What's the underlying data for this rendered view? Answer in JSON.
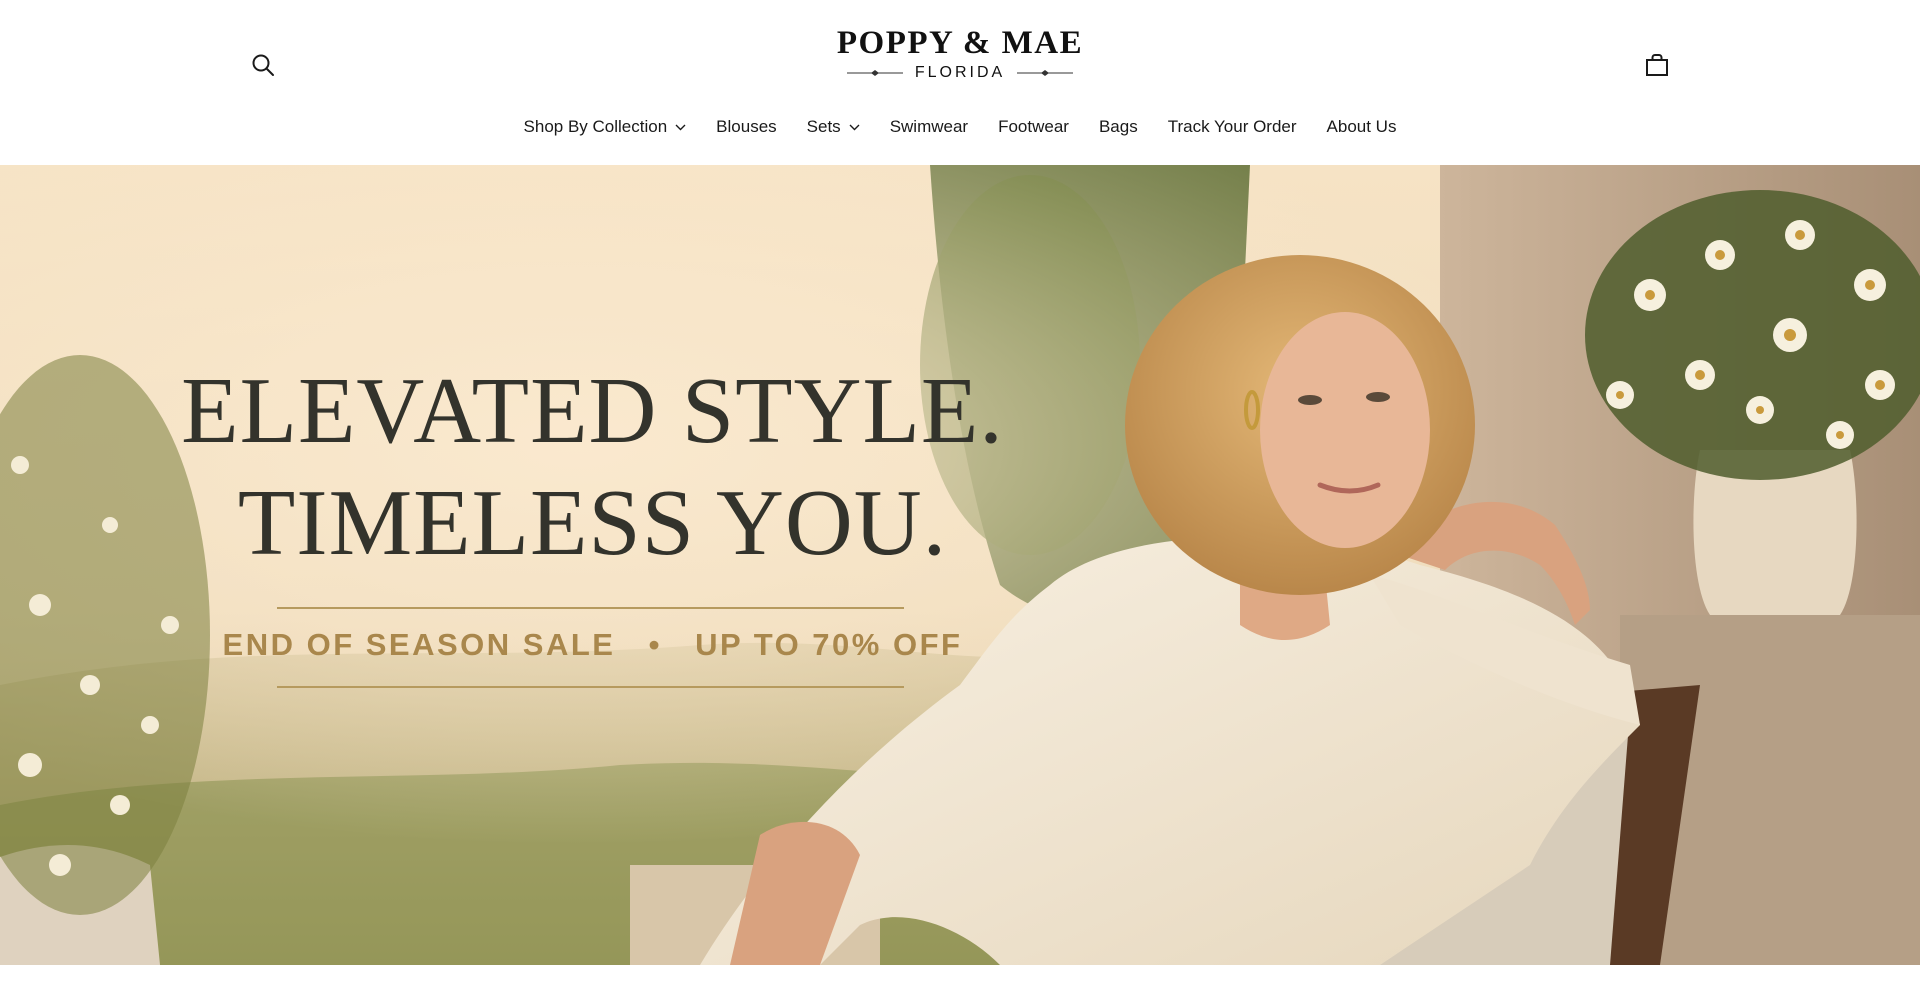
{
  "header": {
    "brand": {
      "name": "POPPY & MAE",
      "location": "FLORIDA"
    },
    "icons": {
      "search": "search-icon",
      "cart": "shopping-bag-icon"
    }
  },
  "nav": {
    "items": [
      {
        "label": "Shop By Collection",
        "has_dropdown": true
      },
      {
        "label": "Blouses",
        "has_dropdown": false
      },
      {
        "label": "Sets",
        "has_dropdown": true
      },
      {
        "label": "Swimwear",
        "has_dropdown": false
      },
      {
        "label": "Footwear",
        "has_dropdown": false
      },
      {
        "label": "Bags",
        "has_dropdown": false
      },
      {
        "label": "Track Your Order",
        "has_dropdown": false
      },
      {
        "label": "About Us",
        "has_dropdown": false
      }
    ]
  },
  "hero": {
    "headline_line1": "ELEVATED STYLE.",
    "headline_line2": "TIMELESS YOU.",
    "sale_left": "END OF SEASON SALE",
    "sale_separator": "•",
    "sale_right": "UP TO 70% OFF"
  },
  "colors": {
    "headline": "#33332c",
    "accent_gold": "#a9874c",
    "rule_gold": "#b69a5e",
    "hero_cream": "#f3e3c6",
    "blouse_cream": "#f5ecdc"
  }
}
